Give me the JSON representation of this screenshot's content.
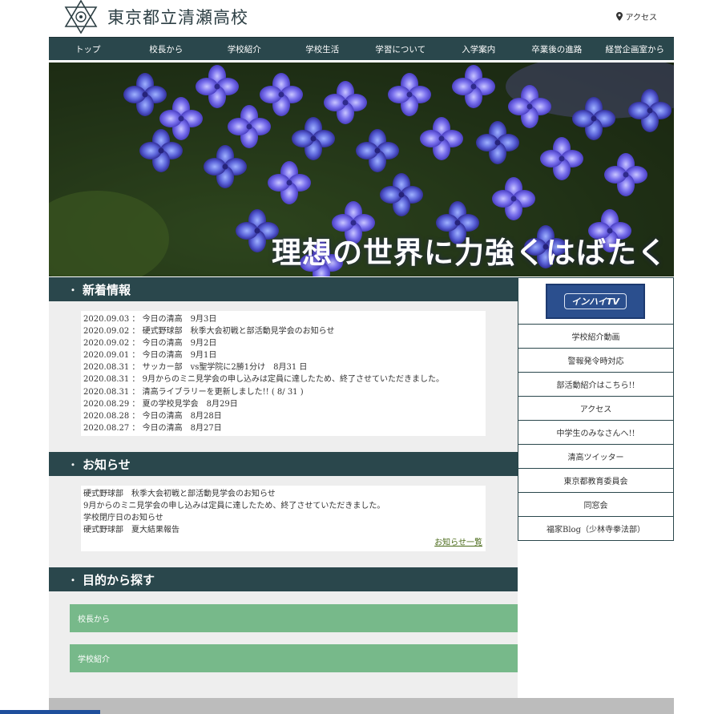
{
  "header": {
    "school_name": "東京都立清瀬高校",
    "access_label": "アクセス"
  },
  "nav": {
    "items": [
      "トップ",
      "校長から",
      "学校紹介",
      "学校生活",
      "学習について",
      "入学案内",
      "卒業後の進路",
      "経営企画室から"
    ]
  },
  "hero": {
    "caption": "理想の世界に力強くはばたく"
  },
  "news": {
    "title": "新着情報",
    "items": [
      "2020.09.03 ： 今日の清高　9月3日",
      "2020.09.02 ： 硬式野球部　秋季大会初戦と部活動見学会のお知らせ",
      "2020.09.02 ： 今日の清高　9月2日",
      "2020.09.01 ： 今日の清高　9月1日",
      "2020.08.31 ： サッカー部　vs聖学院に2勝1分け　8月31 日",
      "2020.08.31 ： 9月からのミニ見学会の申し込みは定員に達したため、終了させていただきました。",
      "2020.08.31 ： 清高ライブラリーを更新しました!! ( 8/ 31 )",
      "2020.08.29 ： 夏の学校見学会　8月29日",
      "2020.08.28 ： 今日の清高　8月28日",
      "2020.08.27 ： 今日の清高　8月27日"
    ]
  },
  "notices": {
    "title": "お知らせ",
    "items": [
      "硬式野球部　秋季大会初戦と部活動見学会のお知らせ",
      "9月からのミニ見学会の申し込みは定員に達したため、終了させていただきました。",
      "学校閉庁日のお知らせ",
      "硬式野球部　夏大結果報告"
    ],
    "more_label": "お知らせ一覧"
  },
  "purpose": {
    "title": "目的から探す",
    "buttons": [
      "校長から",
      "学校紹介"
    ]
  },
  "sidebar": {
    "banner_label": "インハイTV",
    "links": [
      "学校紹介動画",
      "警報発令時対応",
      "部活動紹介はこちら!!",
      "アクセス",
      "中学生のみなさんへ!!",
      "清高ツイッター",
      "東京都教育委員会",
      "同窓会",
      "福家Blog（少林寺拳法部）"
    ]
  },
  "colors": {
    "nav_bg": "#2a474c",
    "green_button": "#77b98a",
    "content_bg": "#eeeeee"
  }
}
